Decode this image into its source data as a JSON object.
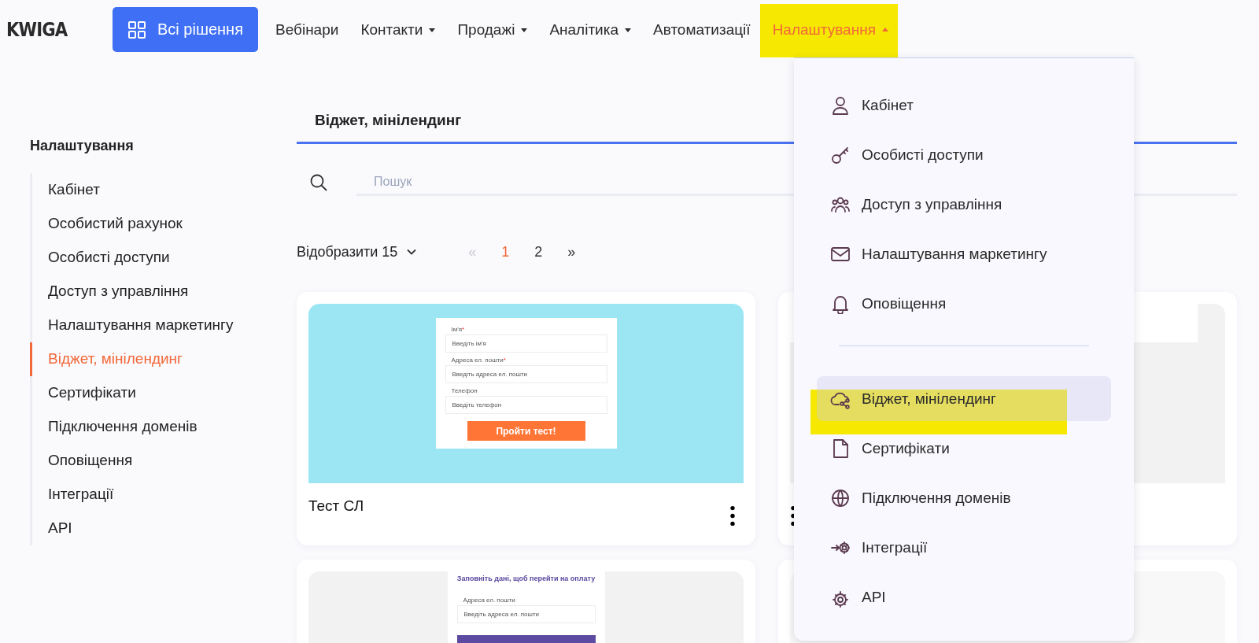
{
  "logo": "KWIGA",
  "header": {
    "all_solutions_button": "Всі рішення",
    "nav": [
      {
        "label": "Вебінари",
        "has_menu": false,
        "selected": false,
        "highlighted": false
      },
      {
        "label": "Контакти",
        "has_menu": true,
        "expanded": false,
        "selected": false,
        "highlighted": false
      },
      {
        "label": "Продажі",
        "has_menu": true,
        "expanded": false,
        "selected": false,
        "highlighted": false
      },
      {
        "label": "Аналітика",
        "has_menu": true,
        "expanded": false,
        "selected": false,
        "highlighted": false
      },
      {
        "label": "Автоматизації",
        "has_menu": false,
        "selected": false,
        "highlighted": false
      },
      {
        "label": "Налаштування",
        "has_menu": true,
        "expanded": true,
        "selected": true,
        "highlighted": true
      }
    ]
  },
  "sidebar": {
    "title": "Налаштування",
    "items": [
      {
        "label": "Кабінет",
        "selected": false
      },
      {
        "label": "Особистий рахунок",
        "selected": false
      },
      {
        "label": "Особисті доступи",
        "selected": false
      },
      {
        "label": "Доступ з управління",
        "selected": false
      },
      {
        "label": "Налаштування маркетингу",
        "selected": false
      },
      {
        "label": "Віджет, мінілендинг",
        "selected": true
      },
      {
        "label": "Сертифікати",
        "selected": false
      },
      {
        "label": "Підключення доменів",
        "selected": false
      },
      {
        "label": "Оповіщення",
        "selected": false
      },
      {
        "label": "Інтеграції",
        "selected": false
      },
      {
        "label": "API",
        "selected": false
      }
    ]
  },
  "page_tab": "Віджет, мінілендинг",
  "search": {
    "placeholder": "Пошук"
  },
  "page_size": {
    "label": "Відобразити 15"
  },
  "pagination": {
    "first": "«",
    "pages": [
      {
        "label": "1",
        "selected": true
      },
      {
        "label": "2",
        "selected": false
      }
    ],
    "last": "»"
  },
  "cards": [
    {
      "kind": "form",
      "title": "Тест СЛ",
      "preview": {
        "fields": [
          {
            "label": "Ім'я",
            "mark": "*",
            "placeholder": "Введіть ім'я"
          },
          {
            "label": "Адреса ел. пошти",
            "mark": "*",
            "placeholder": "Введіть адреса ел. пошти"
          },
          {
            "label": "Телефон",
            "placeholder": "Введіть телефон"
          }
        ],
        "button": "Пройти тест!"
      }
    },
    {
      "kind": "blank"
    },
    {
      "kind": "payment",
      "preview": {
        "heading": "Заповніть дані, щоб перейти на оплату",
        "fields": [
          {
            "label": "Адреса ел. пошти",
            "placeholder": "Введіть адреса ел. пошти"
          }
        ]
      }
    },
    {
      "kind": "empty"
    }
  ],
  "menu": {
    "groups": [
      [
        {
          "label": "Кабінет",
          "selected": false,
          "highlighted": false
        },
        {
          "label": "Особисті доступи",
          "selected": false,
          "highlighted": false
        },
        {
          "label": "Доступ з управління",
          "selected": false,
          "highlighted": false
        },
        {
          "label": "Налаштування маркетингу",
          "selected": false,
          "highlighted": false
        },
        {
          "label": "Оповіщення",
          "selected": false,
          "highlighted": false
        }
      ],
      [
        {
          "label": "Віджет, мінілендинг",
          "selected": true,
          "highlighted": true
        },
        {
          "label": "Сертифікати",
          "selected": false,
          "highlighted": false
        },
        {
          "label": "Підключення доменів",
          "selected": false,
          "highlighted": false
        },
        {
          "label": "Інтеграції",
          "selected": false,
          "highlighted": false
        },
        {
          "label": "API",
          "selected": false,
          "highlighted": false
        }
      ]
    ]
  }
}
